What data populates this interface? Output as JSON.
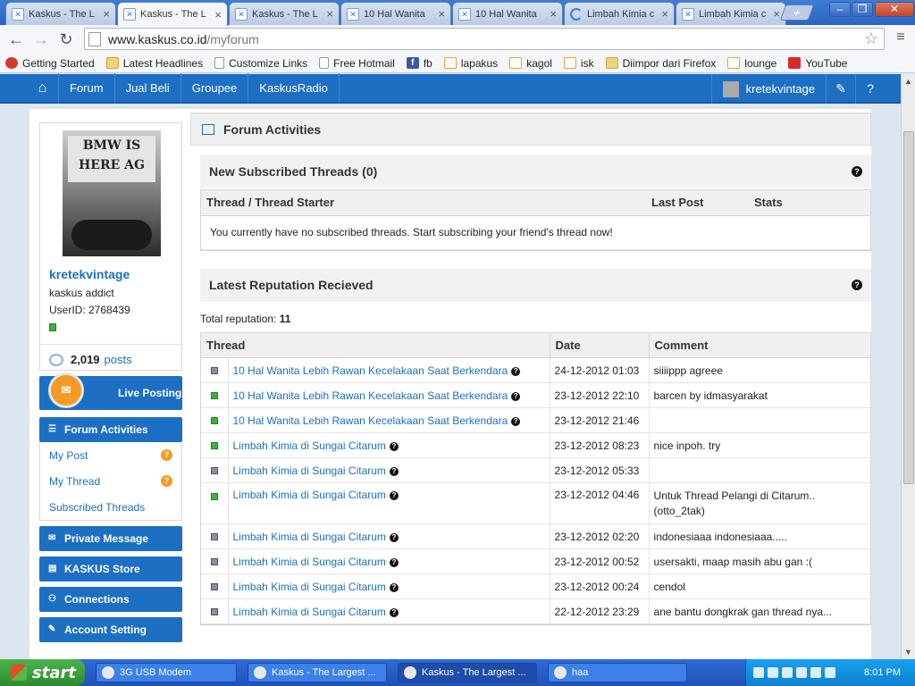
{
  "browser": {
    "tabs": [
      {
        "label": "Kaskus - The L",
        "active": false,
        "loading": false
      },
      {
        "label": "Kaskus - The L",
        "active": true,
        "loading": false
      },
      {
        "label": "Kaskus - The L",
        "active": false,
        "loading": false
      },
      {
        "label": "10 Hal Wanita",
        "active": false,
        "loading": false
      },
      {
        "label": "10 Hal Wanita",
        "active": false,
        "loading": false
      },
      {
        "label": "Limbah Kimia c",
        "active": false,
        "loading": true
      },
      {
        "label": "Limbah Kimia c",
        "active": false,
        "loading": false
      }
    ],
    "url_domain": "www.kaskus.co.id",
    "url_path": "/myforum",
    "bookmarks": [
      {
        "label": "Getting Started",
        "icon": "red"
      },
      {
        "label": "Latest Headlines",
        "icon": "folder"
      },
      {
        "label": "Customize Links",
        "icon": "page"
      },
      {
        "label": "Free Hotmail",
        "icon": "page"
      },
      {
        "label": "fb",
        "icon": "fb"
      },
      {
        "label": "lapakus",
        "icon": "kas"
      },
      {
        "label": "kagol",
        "icon": "kas"
      },
      {
        "label": "isk",
        "icon": "kas"
      },
      {
        "label": "Diimpor dari Firefox",
        "icon": "folder"
      },
      {
        "label": "lounge",
        "icon": "kas"
      },
      {
        "label": "YouTube",
        "icon": "yt"
      }
    ]
  },
  "site_nav": {
    "links": [
      "Forum",
      "Jual Beli",
      "Groupee",
      "KaskusRadio"
    ],
    "username": "kretekvintage"
  },
  "sidebar": {
    "photo_sign": "BMW IS HERE AG",
    "username": "kretekvintage",
    "rank": "kaskus addict",
    "user_id": "UserID: 2768439",
    "post_count": "2,019",
    "posts_label": "posts",
    "live_posting": "Live Posting",
    "forum_activities": "Forum Activities",
    "forum_submenu": [
      {
        "label": "My Post",
        "badge": "?"
      },
      {
        "label": "My Thread",
        "badge": "?"
      },
      {
        "label": "Subscribed Threads",
        "badge": ""
      }
    ],
    "menu": [
      {
        "label": "Private Message",
        "icon": "mail-icon"
      },
      {
        "label": "KASKUS Store",
        "icon": "store-icon"
      },
      {
        "label": "Connections",
        "icon": "connections-icon"
      },
      {
        "label": "Account Setting",
        "icon": "wrench-icon"
      }
    ]
  },
  "main": {
    "title": "Forum Activities",
    "subscribed": {
      "heading": "New Subscribed Threads (0)",
      "columns": [
        "Thread / Thread Starter",
        "Last Post",
        "Stats"
      ],
      "empty_message": "You currently have no subscribed threads. Start subscribing your friend's thread now!"
    },
    "reputation": {
      "heading": "Latest Reputation Recieved",
      "total_label": "Total reputation:",
      "total_value": "11",
      "columns": [
        "Thread",
        "Date",
        "Comment"
      ],
      "rows": [
        {
          "status": "grey",
          "thread": "10 Hal Wanita Lebih Rawan Kecelakaan Saat Berkendara",
          "date": "24-12-2012 01:03",
          "comment": "siiiippp agreee"
        },
        {
          "status": "green",
          "thread": "10 Hal Wanita Lebih Rawan Kecelakaan Saat Berkendara",
          "date": "23-12-2012 22:10",
          "comment": "barcen by idmasyarakat"
        },
        {
          "status": "green",
          "thread": "10 Hal Wanita Lebih Rawan Kecelakaan Saat Berkendara",
          "date": "23-12-2012 21:46",
          "comment": ""
        },
        {
          "status": "green",
          "thread": "Limbah Kimia di Sungai Citarum",
          "date": "23-12-2012 08:23",
          "comment": "nice inpoh. try"
        },
        {
          "status": "grey",
          "thread": "Limbah Kimia di Sungai Citarum",
          "date": "23-12-2012 05:33",
          "comment": ""
        },
        {
          "status": "green",
          "thread": "Limbah Kimia di Sungai Citarum",
          "date": "23-12-2012 04:46",
          "comment": "Untuk Thread Pelangi di Citarum.. (otto_2tak)"
        },
        {
          "status": "grey",
          "thread": "Limbah Kimia di Sungai Citarum",
          "date": "23-12-2012 02:20",
          "comment": "indonesiaaa indonesiaaa....."
        },
        {
          "status": "grey",
          "thread": "Limbah Kimia di Sungai Citarum",
          "date": "23-12-2012 00:52",
          "comment": "usersakti, maap masih abu gan :("
        },
        {
          "status": "grey",
          "thread": "Limbah Kimia di Sungai Citarum",
          "date": "23-12-2012 00:24",
          "comment": "cendol"
        },
        {
          "status": "grey",
          "thread": "Limbah Kimia di Sungai Citarum",
          "date": "22-12-2012 23:29",
          "comment": "ane bantu dongkrak gan thread nya..."
        }
      ]
    }
  },
  "taskbar": {
    "start": "start",
    "tasks": [
      "3G USB Modem",
      "Kaskus - The Largest ...",
      "Kaskus - The Largest ...",
      "haa"
    ],
    "clock": "8:01 PM"
  }
}
